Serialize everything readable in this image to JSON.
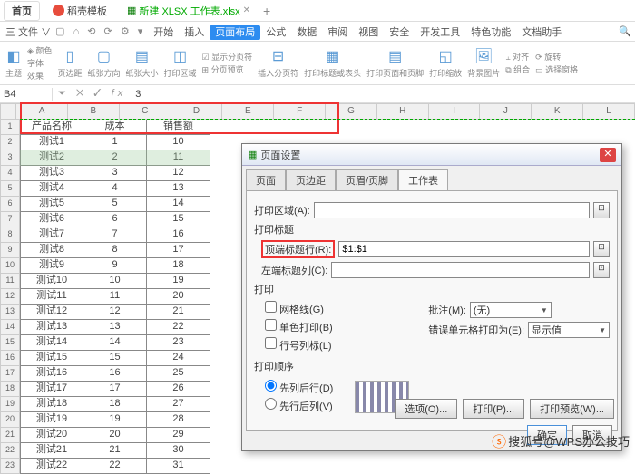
{
  "tabs": {
    "home": "首页",
    "template": "稻壳模板",
    "doc": "新建 XLSX 工作表.xlsx"
  },
  "menu": {
    "file": "三 文件 ∨",
    "items": [
      "开始",
      "插入",
      "页面布局",
      "公式",
      "数据",
      "审阅",
      "视图",
      "安全",
      "开发工具",
      "特色功能",
      "文档助手"
    ],
    "active": 2
  },
  "ribbon": {
    "theme": "主题",
    "colors": "颜色",
    "fonts": "字体",
    "effects": "效果",
    "margins": "页边距",
    "orient": "纸张方向",
    "size": "纸张大小",
    "area": "打印区域",
    "showbreaks": "显示分页符",
    "breaks": "分页预览",
    "insertbreak": "插入分页符",
    "printtitles": "打印标题或表头",
    "printpane": "打印页面和页脚",
    "scale": "打印缩放",
    "bg": "背景图片",
    "align": "对齐",
    "group": "组合",
    "rotate": "旋转",
    "sel": "选择窗格"
  },
  "namebox": {
    "ref": "B4",
    "fx": "3"
  },
  "cols": [
    "A",
    "B",
    "C",
    "D",
    "E",
    "F",
    "G",
    "H",
    "I",
    "J",
    "K",
    "L"
  ],
  "headers": [
    "产品名称",
    "成本",
    "销售额"
  ],
  "rows": [
    [
      "测试1",
      "1",
      "10"
    ],
    [
      "测试2",
      "2",
      "11"
    ],
    [
      "测试3",
      "3",
      "12"
    ],
    [
      "测试4",
      "4",
      "13"
    ],
    [
      "测试5",
      "5",
      "14"
    ],
    [
      "测试6",
      "6",
      "15"
    ],
    [
      "测试7",
      "7",
      "16"
    ],
    [
      "测试8",
      "8",
      "17"
    ],
    [
      "测试9",
      "9",
      "18"
    ],
    [
      "测试10",
      "10",
      "19"
    ],
    [
      "测试11",
      "11",
      "20"
    ],
    [
      "测试12",
      "12",
      "21"
    ],
    [
      "测试13",
      "13",
      "22"
    ],
    [
      "测试14",
      "14",
      "23"
    ],
    [
      "测试15",
      "15",
      "24"
    ],
    [
      "测试16",
      "16",
      "25"
    ],
    [
      "测试17",
      "17",
      "26"
    ],
    [
      "测试18",
      "18",
      "27"
    ],
    [
      "测试19",
      "19",
      "28"
    ],
    [
      "测试20",
      "20",
      "29"
    ],
    [
      "测试21",
      "21",
      "30"
    ],
    [
      "测试22",
      "22",
      "31"
    ]
  ],
  "dialog": {
    "title": "页面设置",
    "tabs": [
      "页面",
      "页边距",
      "页眉/页脚",
      "工作表"
    ],
    "active": 3,
    "printarea_lbl": "打印区域(A):",
    "titles_section": "打印标题",
    "toprow_lbl": "顶端标题行(R):",
    "toprow_val": "$1:$1",
    "leftcol_lbl": "左端标题列(C):",
    "print_section": "打印",
    "grid": "网格线(G)",
    "bw": "单色打印(B)",
    "rowcol": "行号列标(L)",
    "comments_lbl": "批注(M):",
    "comments_val": "(无)",
    "errors_lbl": "错误单元格打印为(E):",
    "errors_val": "显示值",
    "order_section": "打印顺序",
    "order1": "先列后行(D)",
    "order2": "先行后列(V)",
    "options": "选项(O)...",
    "print": "打印(P)...",
    "preview": "打印预览(W)...",
    "ok": "确定",
    "cancel": "取消"
  },
  "watermark": "搜狐号@WPS办公技巧"
}
